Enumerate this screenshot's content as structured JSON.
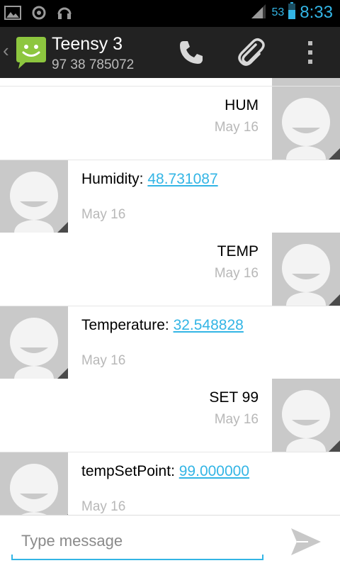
{
  "status_bar": {
    "battery_percent": "53",
    "time": "8:33",
    "icons": [
      "image-icon",
      "sync-icon",
      "headset-icon",
      "signal-icon",
      "battery-icon"
    ]
  },
  "action_bar": {
    "contact_name": "Teensy 3",
    "contact_number": "97 38 785072",
    "icons": [
      "messaging-app-icon",
      "phone-icon",
      "attach-icon",
      "overflow-menu-icon"
    ]
  },
  "messages": [
    {
      "direction": "sent",
      "text": "HUM",
      "date": "May 16"
    },
    {
      "direction": "received",
      "label": "Humidity: ",
      "value": "48.731087",
      "date": "May 16"
    },
    {
      "direction": "sent",
      "text": "TEMP",
      "date": "May 16"
    },
    {
      "direction": "received",
      "label": "Temperature: ",
      "value": "32.548828",
      "date": "May 16"
    },
    {
      "direction": "sent",
      "text": "SET 99",
      "date": "May 16"
    },
    {
      "direction": "received",
      "label": "tempSetPoint: ",
      "value": "99.000000",
      "date": "May 16"
    }
  ],
  "compose": {
    "placeholder": "Type message",
    "send_icon": "send-icon"
  },
  "colors": {
    "accent": "#33b5e5",
    "action_bar": "#222222",
    "avatar_bg": "#c9c9c9"
  }
}
